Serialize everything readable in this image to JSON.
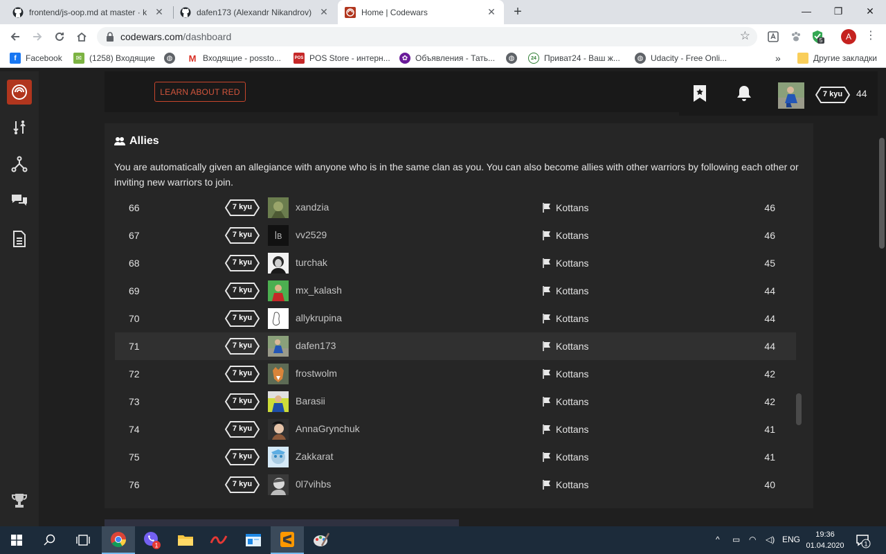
{
  "browser": {
    "tabs": [
      {
        "title": "frontend/js-oop.md at master · k"
      },
      {
        "title": "dafen173 (Alexandr Nikandrov)"
      },
      {
        "title": "Home | Codewars"
      }
    ],
    "url_host": "codewars.com",
    "url_path": "/dashboard",
    "profile_initial": "A",
    "ext_badge": "5",
    "bookmarks": [
      {
        "label": "Facebook"
      },
      {
        "label": "(1258) Входящие"
      },
      {
        "label": ""
      },
      {
        "label": "Входящие - possto..."
      },
      {
        "label": "POS Store - интерн..."
      },
      {
        "label": "Объявления - Тать..."
      },
      {
        "label": ""
      },
      {
        "label": "Приват24 - Ваш ж..."
      },
      {
        "label": "Udacity - Free Onli..."
      }
    ],
    "more_bookmarks": "»",
    "other_bookmarks": "Другие закладки"
  },
  "page": {
    "learn_button": "LEARN ABOUT RED",
    "user_rank": "7 kyu",
    "user_honor": "44",
    "allies_title": "Allies",
    "allies_desc": "You are automatically given an allegiance with anyone who is in the same clan as you. You can also become allies with other warriors by following each other or inviting new warriors to join.",
    "rows": [
      {
        "rank": "66",
        "kyu": "7 kyu",
        "name": "xandzia",
        "clan": "Kottans",
        "score": "46"
      },
      {
        "rank": "67",
        "kyu": "7 kyu",
        "name": "vv2529",
        "clan": "Kottans",
        "score": "46"
      },
      {
        "rank": "68",
        "kyu": "7 kyu",
        "name": "turchak",
        "clan": "Kottans",
        "score": "45"
      },
      {
        "rank": "69",
        "kyu": "7 kyu",
        "name": "mx_kalash",
        "clan": "Kottans",
        "score": "44"
      },
      {
        "rank": "70",
        "kyu": "7 kyu",
        "name": "allykrupina",
        "clan": "Kottans",
        "score": "44"
      },
      {
        "rank": "71",
        "kyu": "7 kyu",
        "name": "dafen173",
        "clan": "Kottans",
        "score": "44"
      },
      {
        "rank": "72",
        "kyu": "7 kyu",
        "name": "frostwolm",
        "clan": "Kottans",
        "score": "42"
      },
      {
        "rank": "73",
        "kyu": "7 kyu",
        "name": "Barasii",
        "clan": "Kottans",
        "score": "42"
      },
      {
        "rank": "74",
        "kyu": "7 kyu",
        "name": "AnnaGrynchuk",
        "clan": "Kottans",
        "score": "41"
      },
      {
        "rank": "75",
        "kyu": "7 kyu",
        "name": "Zakkarat",
        "clan": "Kottans",
        "score": "41"
      },
      {
        "rank": "76",
        "kyu": "7 kyu",
        "name": "0l7vihbs",
        "clan": "Kottans",
        "score": "40"
      }
    ],
    "vv_avatar_text": "ꟾB"
  },
  "taskbar": {
    "viber_badge": "1",
    "lang": "ENG",
    "time": "19:36",
    "date": "01.04.2020",
    "notif_count": "1"
  },
  "colors": {
    "codewars_red": "#b1361e",
    "page_bg": "#1f1f1f",
    "card_bg": "#262626",
    "highlight_row": "#303030"
  }
}
